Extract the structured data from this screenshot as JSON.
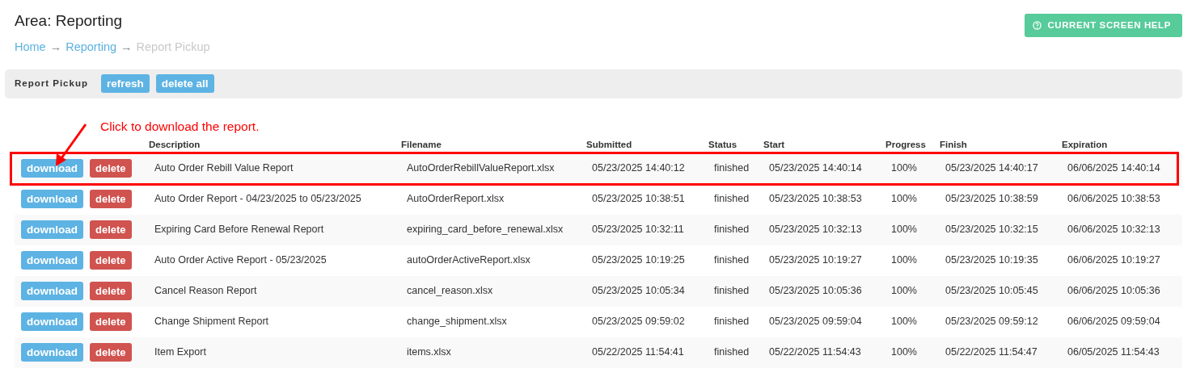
{
  "area_title": "Area: Reporting",
  "breadcrumbs": [
    {
      "label": "Home",
      "kind": "link"
    },
    {
      "label": "Reporting",
      "kind": "link"
    },
    {
      "label": "Report Pickup",
      "kind": "current"
    }
  ],
  "breadcrumb_separator": "→",
  "help_button": {
    "label": "CURRENT SCREEN HELP"
  },
  "toolbar": {
    "label": "Report Pickup",
    "buttons": [
      "refresh",
      "delete all"
    ]
  },
  "annotation": {
    "text": "Click to download the report."
  },
  "table": {
    "columns": [
      "Description",
      "Filename",
      "Submitted",
      "Status",
      "Start",
      "Progress",
      "Finish",
      "Expiration"
    ],
    "rows": [
      {
        "annotated": true,
        "buttons": [
          "download",
          "delete"
        ],
        "cells": [
          "Auto Order Rebill Value Report",
          "AutoOrderRebillValueReport.xlsx",
          "05/23/2025 14:40:12",
          "finished",
          "05/23/2025 14:40:14",
          "100%",
          "05/23/2025 14:40:17",
          "06/06/2025 14:40:14"
        ]
      },
      {
        "annotated": false,
        "buttons": [
          "download",
          "delete"
        ],
        "cells": [
          "Auto Order Report - 04/23/2025 to 05/23/2025",
          "AutoOrderReport.xlsx",
          "05/23/2025 10:38:51",
          "finished",
          "05/23/2025 10:38:53",
          "100%",
          "05/23/2025 10:38:59",
          "06/06/2025 10:38:53"
        ]
      },
      {
        "annotated": false,
        "buttons": [
          "download",
          "delete"
        ],
        "cells": [
          "Expiring Card Before Renewal Report",
          "expiring_card_before_renewal.xlsx",
          "05/23/2025 10:32:11",
          "finished",
          "05/23/2025 10:32:13",
          "100%",
          "05/23/2025 10:32:15",
          "06/06/2025 10:32:13"
        ]
      },
      {
        "annotated": false,
        "buttons": [
          "download",
          "delete"
        ],
        "cells": [
          "Auto Order Active Report - 05/23/2025",
          "autoOrderActiveReport.xlsx",
          "05/23/2025 10:19:25",
          "finished",
          "05/23/2025 10:19:27",
          "100%",
          "05/23/2025 10:19:35",
          "06/06/2025 10:19:27"
        ]
      },
      {
        "annotated": false,
        "buttons": [
          "download",
          "delete"
        ],
        "cells": [
          "Cancel Reason Report",
          "cancel_reason.xlsx",
          "05/23/2025 10:05:34",
          "finished",
          "05/23/2025 10:05:36",
          "100%",
          "05/23/2025 10:05:45",
          "06/06/2025 10:05:36"
        ]
      },
      {
        "annotated": false,
        "buttons": [
          "download",
          "delete"
        ],
        "cells": [
          "Change Shipment Report",
          "change_shipment.xlsx",
          "05/23/2025 09:59:02",
          "finished",
          "05/23/2025 09:59:04",
          "100%",
          "05/23/2025 09:59:12",
          "06/06/2025 09:59:04"
        ]
      },
      {
        "annotated": false,
        "buttons": [
          "download",
          "delete"
        ],
        "cells": [
          "Item Export",
          "items.xlsx",
          "05/22/2025 11:54:41",
          "finished",
          "05/22/2025 11:54:43",
          "100%",
          "05/22/2025 11:54:47",
          "06/05/2025 11:54:43"
        ]
      }
    ]
  }
}
